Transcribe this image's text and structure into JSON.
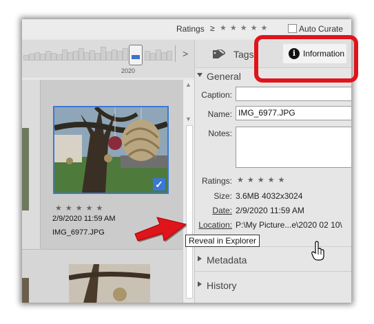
{
  "topbar": {
    "ratings_label": "Ratings",
    "ratings_operator": "≥",
    "ratings_stars": "★★★★★",
    "auto_curate_label": "Auto Curate",
    "auto_curate_checked": false
  },
  "timeline": {
    "year_label": "2020",
    "next_glyph": ">"
  },
  "grid": {
    "selected_item": {
      "stars": "★★★★★",
      "date": "2/9/2020 11:59 AM",
      "filename": "IMG_6977.JPG",
      "selected": true
    }
  },
  "panel": {
    "tabs": [
      {
        "label": "Tags",
        "icon": "tag-icon"
      },
      {
        "label": "Information",
        "icon": "info-icon",
        "active": true
      }
    ],
    "general": {
      "title": "General",
      "caption_label": "Caption:",
      "caption_value": "",
      "name_label": "Name:",
      "name_value": "IMG_6977.JPG",
      "notes_label": "Notes:",
      "notes_value": "",
      "ratings_label": "Ratings:",
      "ratings_stars": "★★★★★",
      "size_label": "Size:",
      "size_value": "3.6MB  4032x3024",
      "date_label": "Date:",
      "date_value": "2/9/2020 11:59 AM",
      "location_label": "Location:",
      "location_value": "P:\\My Picture...e\\2020 02 10\\"
    },
    "tooltip": "Reveal in Explorer",
    "metadata_title": "Metadata",
    "history_title": "History"
  },
  "colors": {
    "accent": "#3a78d6",
    "annotation_red": "#e0141b"
  }
}
